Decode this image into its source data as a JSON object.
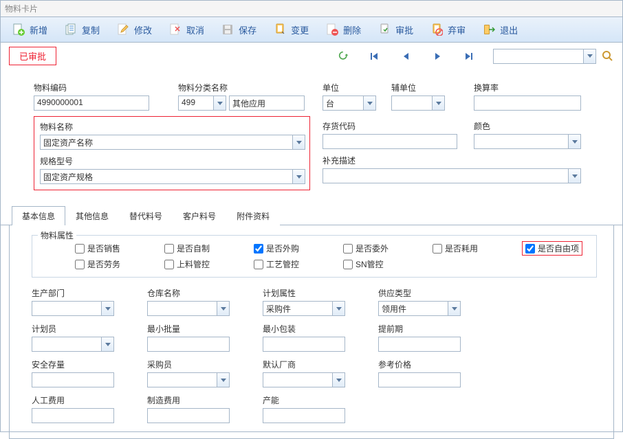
{
  "window_title": "物料卡片",
  "toolbar": {
    "new": "新增",
    "copy": "复制",
    "edit": "修改",
    "cancel": "取消",
    "save": "保存",
    "change": "变更",
    "delete": "删除",
    "audit": "审批",
    "abandon": "弃审",
    "exit": "退出"
  },
  "status": "已审批",
  "form": {
    "material_code": {
      "label": "物料编码",
      "value": "4990000001"
    },
    "category_name": {
      "label": "物料分类名称",
      "code": "499",
      "name": "其他应用"
    },
    "unit": {
      "label": "单位",
      "value": "台"
    },
    "aux_unit": {
      "label": "辅单位",
      "value": ""
    },
    "rate": {
      "label": "换算率",
      "value": ""
    },
    "material_name": {
      "label": "物料名称",
      "value": "固定资产名称"
    },
    "stock_code": {
      "label": "存货代码",
      "value": ""
    },
    "color": {
      "label": "颜色",
      "value": ""
    },
    "spec": {
      "label": "规格型号",
      "value": "固定资产规格"
    },
    "supplement": {
      "label": "补充描述",
      "value": ""
    }
  },
  "tabs": [
    "基本信息",
    "其他信息",
    "替代料号",
    "客户料号",
    "附件资料"
  ],
  "attr_legend": "物料属性",
  "checks": {
    "sale": "是否销售",
    "selfmade": "是否自制",
    "outsource": "是否外购",
    "consign": "是否委外",
    "consume": "是否耗用",
    "free": "是否自由项",
    "labor": "是否劳务",
    "feed": "上料管控",
    "process": "工艺管控",
    "sn": "SN管控"
  },
  "grid": {
    "dept": {
      "label": "生产部门",
      "value": ""
    },
    "warehouse": {
      "label": "仓库名称",
      "value": ""
    },
    "plan_attr": {
      "label": "计划属性",
      "value": "采购件"
    },
    "supply_type": {
      "label": "供应类型",
      "value": "领用件"
    },
    "planner": {
      "label": "计划员",
      "value": ""
    },
    "min_batch": {
      "label": "最小批量",
      "value": ""
    },
    "min_pack": {
      "label": "最小包装",
      "value": ""
    },
    "lead_time": {
      "label": "提前期",
      "value": ""
    },
    "safe_stock": {
      "label": "安全存量",
      "value": ""
    },
    "buyer": {
      "label": "采购员",
      "value": ""
    },
    "default_vendor": {
      "label": "默认厂商",
      "value": ""
    },
    "ref_price": {
      "label": "参考价格",
      "value": ""
    },
    "labor_cost": {
      "label": "人工费用",
      "value": ""
    },
    "mfg_cost": {
      "label": "制造费用",
      "value": ""
    },
    "capacity": {
      "label": "产能",
      "value": ""
    }
  }
}
